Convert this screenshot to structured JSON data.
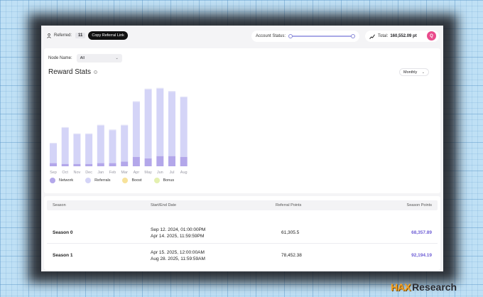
{
  "topbar": {
    "referred_label": "Referred:",
    "referred_count": "11",
    "copy_button": "Copy Referral Link",
    "status_label": "Account Status:",
    "status_level": 0.97,
    "total_label": "Total:",
    "total_value": "160,552.09 pt",
    "avatar_initial": "Q"
  },
  "filters": {
    "node_label": "Node Name:",
    "node_value": "All",
    "period_value": "Monthly"
  },
  "stats": {
    "title": "Reward Stats"
  },
  "chart_data": {
    "type": "bar",
    "stacked": true,
    "categories": [
      "Sep",
      "Oct",
      "Nov",
      "Dec",
      "Jan",
      "Feb",
      "Mar",
      "Apr",
      "May",
      "Jun",
      "Jul",
      "Aug"
    ],
    "series": [
      {
        "name": "Network",
        "color": "#b3a7ea",
        "values": [
          4,
          3,
          3,
          3,
          4,
          4,
          6,
          12,
          10,
          13,
          13,
          12
        ]
      },
      {
        "name": "Referrals",
        "color": "#d4d4f7",
        "values": [
          25,
          46,
          38,
          38,
          48,
          42,
          46,
          70,
          88,
          86,
          82,
          76
        ]
      },
      {
        "name": "Boost",
        "color": "#f7e29a",
        "values": [
          0,
          0,
          0,
          0,
          0,
          0,
          0,
          0,
          0,
          0,
          0,
          0
        ]
      },
      {
        "name": "Bonus",
        "color": "#e4f0b0",
        "values": [
          0,
          0,
          0,
          0,
          0,
          0,
          0,
          0,
          0,
          0,
          0,
          0
        ]
      }
    ],
    "ylim": [
      0,
      105
    ]
  },
  "table": {
    "headers": [
      "Season",
      "Start/End Date",
      "Referral Points",
      "Season Points"
    ],
    "rows": [
      {
        "season": "Season 0",
        "start": "Sep 12. 2024, 01:00:00PM",
        "end": "Apr 14. 2025, 11:59:59PM",
        "referral": "61,305.5",
        "points": "68,357.89"
      },
      {
        "season": "Season 1",
        "start": "Apr 15. 2025, 12:00:00AM",
        "end": "Aug 28. 2025, 11:59:59AM",
        "referral": "78,452.38",
        "points": "92,194.19"
      }
    ]
  },
  "watermark": {
    "brand": "HAX",
    "text": "Research"
  }
}
